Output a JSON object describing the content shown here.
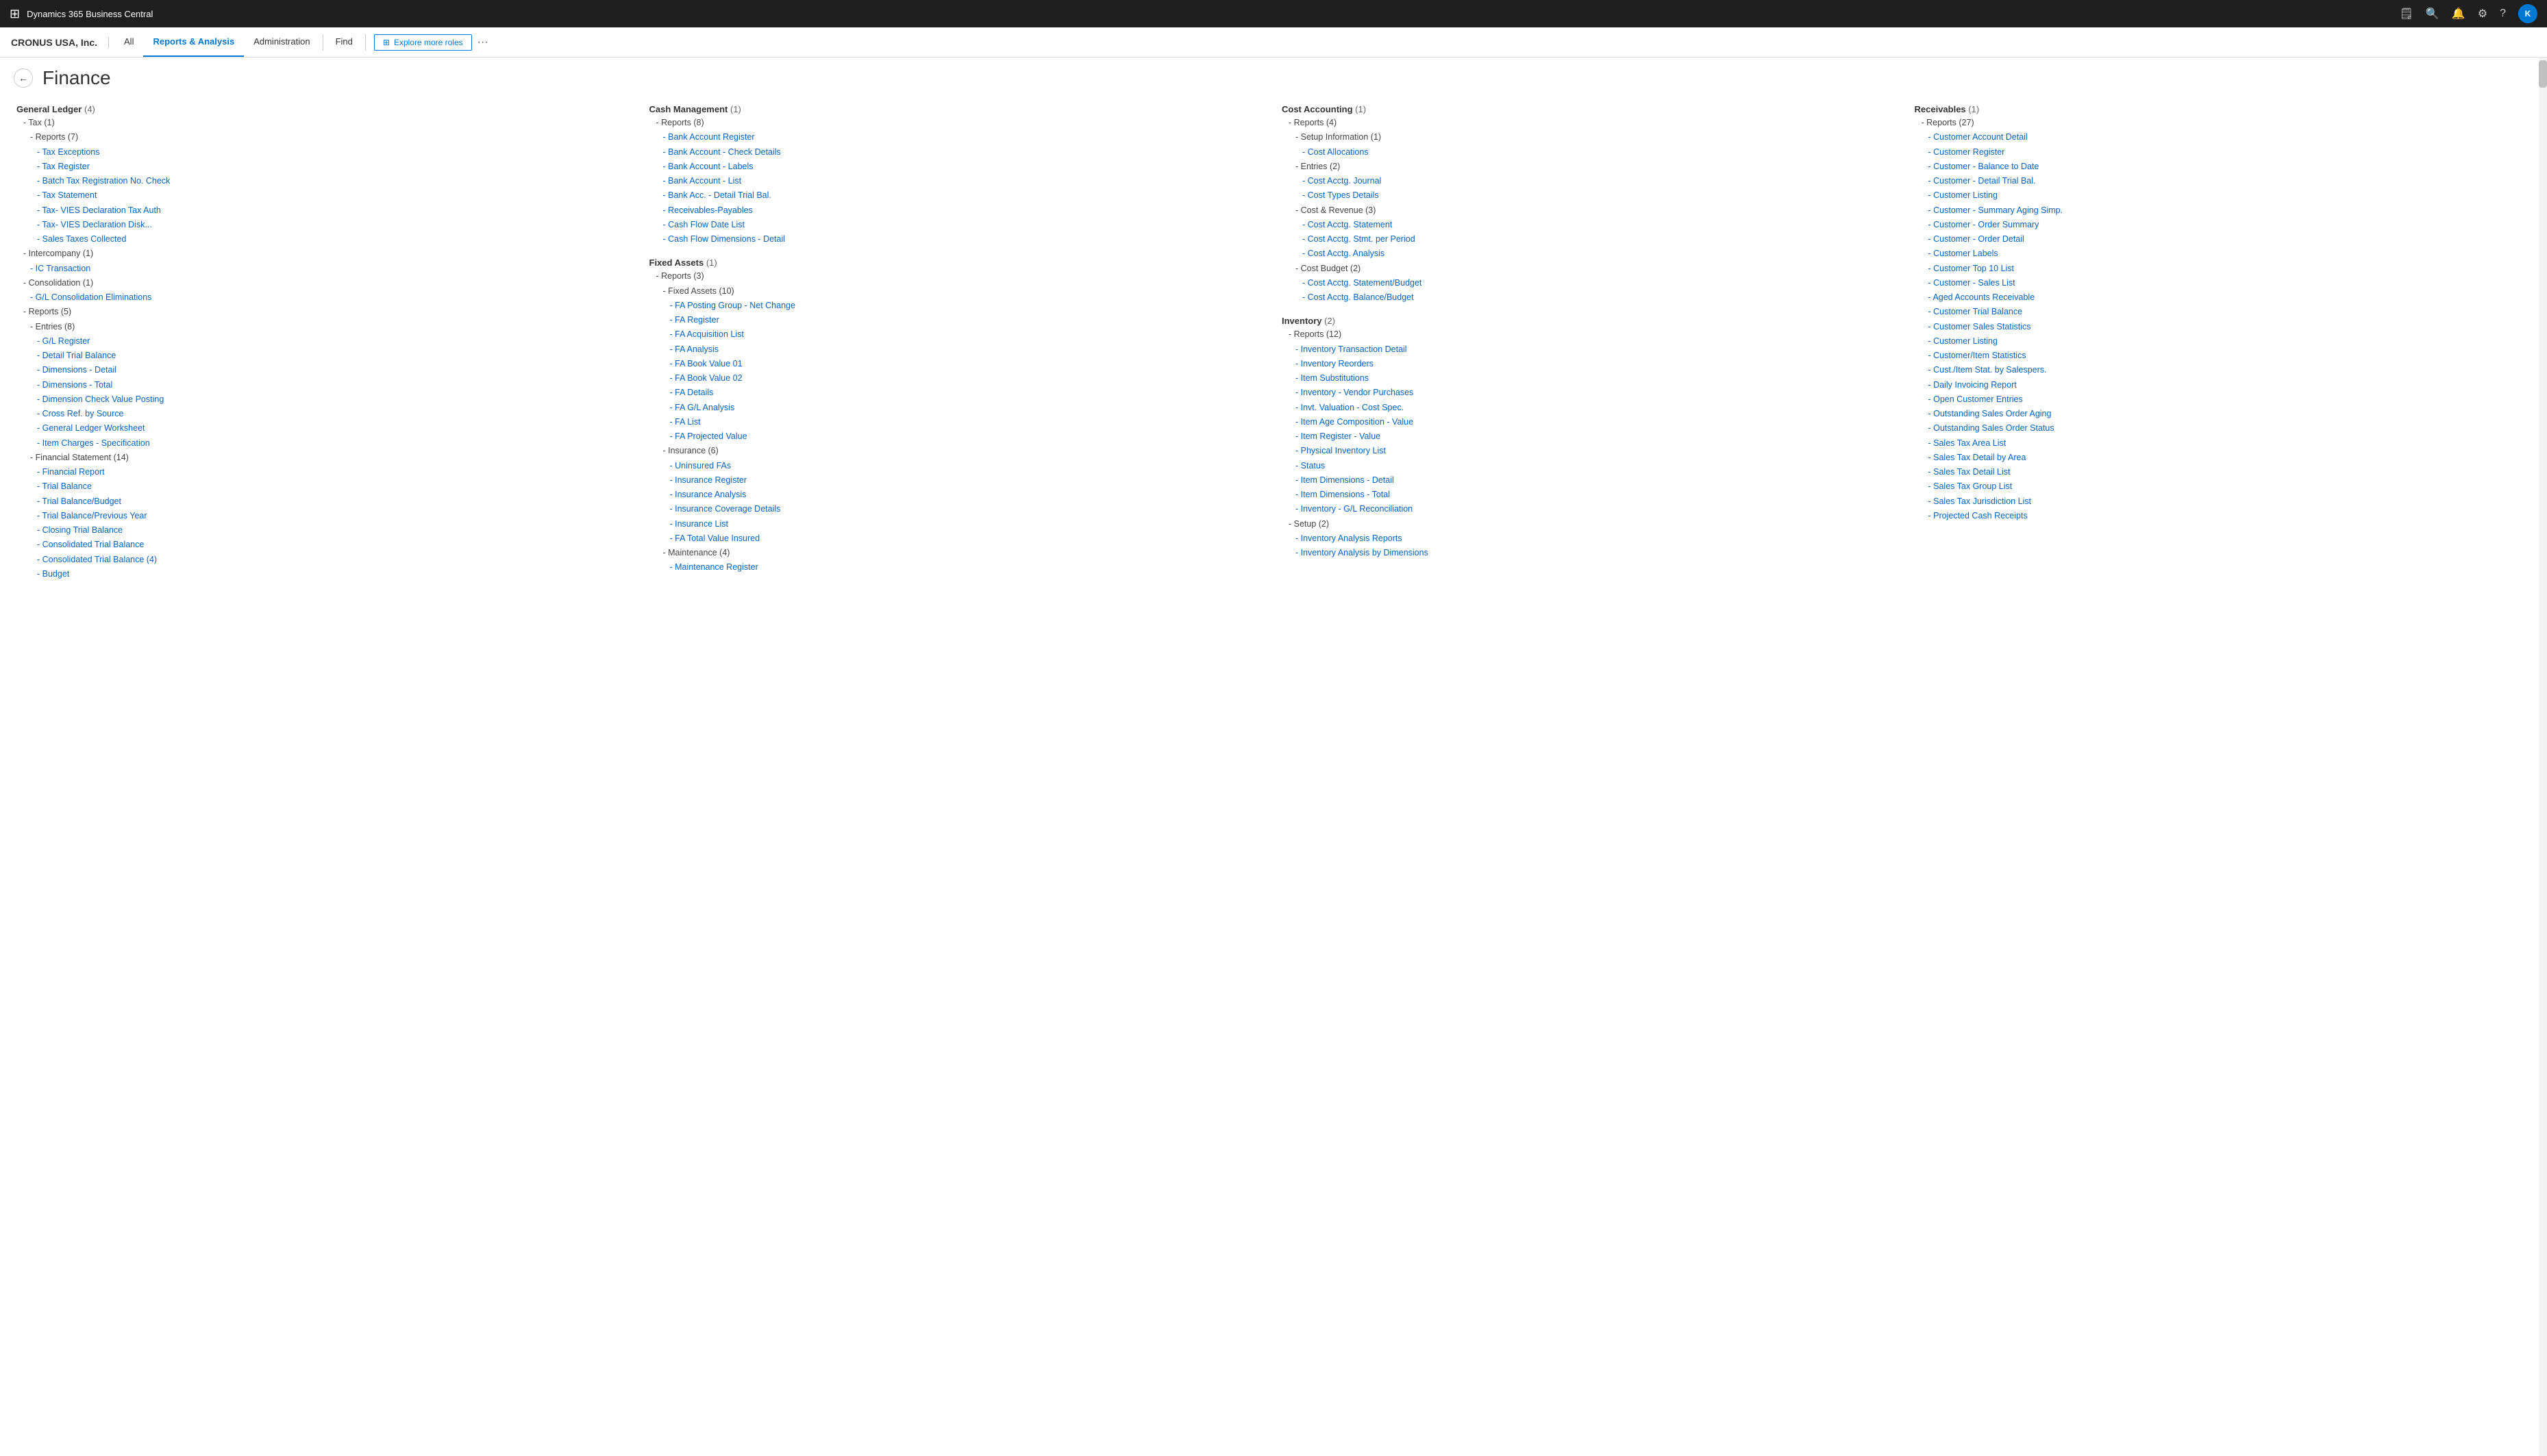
{
  "topbar": {
    "title": "Dynamics 365 Business Central",
    "avatar": "K"
  },
  "companybar": {
    "company": "CRONUS USA, Inc.",
    "tabs": [
      "All",
      "Reports & Analysis",
      "Administration",
      "Find"
    ],
    "active_tab": "Reports & Analysis",
    "explore_label": "Explore more roles"
  },
  "page": {
    "title": "Finance",
    "back": "back"
  },
  "columns": {
    "col1": {
      "header": "General Ledger",
      "count": "(4)",
      "sections": [
        {
          "label": "- Tax (1)",
          "indent": 1,
          "link": false
        },
        {
          "label": "- Reports (7)",
          "indent": 2,
          "link": false
        },
        {
          "label": "- Tax Exceptions",
          "indent": 3,
          "link": true
        },
        {
          "label": "- Tax Register",
          "indent": 3,
          "link": true
        },
        {
          "label": "- Batch Tax Registration No. Check",
          "indent": 3,
          "link": true
        },
        {
          "label": "- Tax Statement",
          "indent": 3,
          "link": true
        },
        {
          "label": "- Tax- VIES Declaration Tax Auth",
          "indent": 3,
          "link": true
        },
        {
          "label": "- Tax- VIES Declaration Disk...",
          "indent": 3,
          "link": true
        },
        {
          "label": "- Sales Taxes Collected",
          "indent": 3,
          "link": true
        },
        {
          "label": "- Intercompany (1)",
          "indent": 1,
          "link": false
        },
        {
          "label": "- IC Transaction",
          "indent": 2,
          "link": true
        },
        {
          "label": "- Consolidation (1)",
          "indent": 1,
          "link": false
        },
        {
          "label": "- G/L Consolidation Eliminations",
          "indent": 2,
          "link": true
        },
        {
          "label": "- Reports (5)",
          "indent": 1,
          "link": false
        },
        {
          "label": "- Entries (8)",
          "indent": 2,
          "link": false
        },
        {
          "label": "- G/L Register",
          "indent": 3,
          "link": true
        },
        {
          "label": "- Detail Trial Balance",
          "indent": 3,
          "link": true
        },
        {
          "label": "- Dimensions - Detail",
          "indent": 3,
          "link": true
        },
        {
          "label": "- Dimensions - Total",
          "indent": 3,
          "link": true
        },
        {
          "label": "- Dimension Check Value Posting",
          "indent": 3,
          "link": true
        },
        {
          "label": "- Cross Ref. by Source",
          "indent": 3,
          "link": true
        },
        {
          "label": "- General Ledger Worksheet",
          "indent": 3,
          "link": true
        },
        {
          "label": "- Item Charges - Specification",
          "indent": 3,
          "link": true
        },
        {
          "label": "- Financial Statement (14)",
          "indent": 2,
          "link": false
        },
        {
          "label": "- Financial Report",
          "indent": 3,
          "link": true
        },
        {
          "label": "- Trial Balance",
          "indent": 3,
          "link": true
        },
        {
          "label": "- Trial Balance/Budget",
          "indent": 3,
          "link": true
        },
        {
          "label": "- Trial Balance/Previous Year",
          "indent": 3,
          "link": true
        },
        {
          "label": "- Closing Trial Balance",
          "indent": 3,
          "link": true
        },
        {
          "label": "- Consolidated Trial Balance",
          "indent": 3,
          "link": true
        },
        {
          "label": "- Consolidated Trial Balance (4)",
          "indent": 3,
          "link": true
        },
        {
          "label": "- Budget",
          "indent": 3,
          "link": true
        }
      ]
    },
    "col2": {
      "header": "Cash Management",
      "count": "(1)",
      "sections": [
        {
          "label": "- Reports (8)",
          "indent": 1,
          "link": false
        },
        {
          "label": "- Bank Account Register",
          "indent": 2,
          "link": true
        },
        {
          "label": "- Bank Account - Check Details",
          "indent": 2,
          "link": true
        },
        {
          "label": "- Bank Account - Labels",
          "indent": 2,
          "link": true
        },
        {
          "label": "- Bank Account - List",
          "indent": 2,
          "link": true
        },
        {
          "label": "- Bank Acc. - Detail Trial Bal.",
          "indent": 2,
          "link": true
        },
        {
          "label": "- Receivables-Payables",
          "indent": 2,
          "link": true
        },
        {
          "label": "- Cash Flow Date List",
          "indent": 2,
          "link": true
        },
        {
          "label": "- Cash Flow Dimensions - Detail",
          "indent": 2,
          "link": true
        },
        {
          "label": "Fixed Assets",
          "indent": 0,
          "link": false,
          "header": true,
          "count": "(1)"
        },
        {
          "label": "- Reports (3)",
          "indent": 1,
          "link": false
        },
        {
          "label": "- Fixed Assets (10)",
          "indent": 2,
          "link": false
        },
        {
          "label": "- FA Posting Group - Net Change",
          "indent": 3,
          "link": true
        },
        {
          "label": "- FA Register",
          "indent": 3,
          "link": true
        },
        {
          "label": "- FA Acquisition List",
          "indent": 3,
          "link": true
        },
        {
          "label": "- FA Analysis",
          "indent": 3,
          "link": true
        },
        {
          "label": "- FA Book Value 01",
          "indent": 3,
          "link": true
        },
        {
          "label": "- FA Book Value 02",
          "indent": 3,
          "link": true
        },
        {
          "label": "- FA Details",
          "indent": 3,
          "link": true
        },
        {
          "label": "- FA G/L Analysis",
          "indent": 3,
          "link": true
        },
        {
          "label": "- FA List",
          "indent": 3,
          "link": true
        },
        {
          "label": "- FA Projected Value",
          "indent": 3,
          "link": true
        },
        {
          "label": "- Insurance (6)",
          "indent": 2,
          "link": false
        },
        {
          "label": "- Uninsured FAs",
          "indent": 3,
          "link": true
        },
        {
          "label": "- Insurance Register",
          "indent": 3,
          "link": true
        },
        {
          "label": "- Insurance Analysis",
          "indent": 3,
          "link": true
        },
        {
          "label": "- Insurance Coverage Details",
          "indent": 3,
          "link": true
        },
        {
          "label": "- Insurance List",
          "indent": 3,
          "link": true
        },
        {
          "label": "- FA Total Value Insured",
          "indent": 3,
          "link": true
        },
        {
          "label": "- Maintenance (4)",
          "indent": 2,
          "link": false
        },
        {
          "label": "- Maintenance Register",
          "indent": 3,
          "link": true
        }
      ]
    },
    "col3": {
      "header": "Cost Accounting",
      "count": "(1)",
      "sections": [
        {
          "label": "- Reports (4)",
          "indent": 1,
          "link": false
        },
        {
          "label": "- Setup Information (1)",
          "indent": 2,
          "link": false
        },
        {
          "label": "- Cost Allocations",
          "indent": 3,
          "link": true
        },
        {
          "label": "- Entries (2)",
          "indent": 2,
          "link": false
        },
        {
          "label": "- Cost Acctg. Journal",
          "indent": 3,
          "link": true
        },
        {
          "label": "- Cost Types Details",
          "indent": 3,
          "link": true
        },
        {
          "label": "- Cost & Revenue (3)",
          "indent": 2,
          "link": false
        },
        {
          "label": "- Cost Acctg. Statement",
          "indent": 3,
          "link": true
        },
        {
          "label": "- Cost Acctg. Stmt. per Period",
          "indent": 3,
          "link": true
        },
        {
          "label": "- Cost Acctg. Analysis",
          "indent": 3,
          "link": true
        },
        {
          "label": "- Cost Budget (2)",
          "indent": 2,
          "link": false
        },
        {
          "label": "- Cost Acctg. Statement/Budget",
          "indent": 3,
          "link": true
        },
        {
          "label": "- Cost Acctg. Balance/Budget",
          "indent": 3,
          "link": true
        },
        {
          "label": "Inventory",
          "indent": 0,
          "link": false,
          "header": true,
          "count": "(2)"
        },
        {
          "label": "- Reports (12)",
          "indent": 1,
          "link": false
        },
        {
          "label": "- Inventory Transaction Detail",
          "indent": 2,
          "link": true
        },
        {
          "label": "- Inventory Reorders",
          "indent": 2,
          "link": true
        },
        {
          "label": "- Item Substitutions",
          "indent": 2,
          "link": true
        },
        {
          "label": "- Inventory - Vendor Purchases",
          "indent": 2,
          "link": true
        },
        {
          "label": "- Invt. Valuation - Cost Spec.",
          "indent": 2,
          "link": true
        },
        {
          "label": "- Item Age Composition - Value",
          "indent": 2,
          "link": true
        },
        {
          "label": "- Item Register - Value",
          "indent": 2,
          "link": true
        },
        {
          "label": "- Physical Inventory List",
          "indent": 2,
          "link": true
        },
        {
          "label": "- Status",
          "indent": 2,
          "link": true
        },
        {
          "label": "- Item Dimensions - Detail",
          "indent": 2,
          "link": true
        },
        {
          "label": "- Item Dimensions - Total",
          "indent": 2,
          "link": true
        },
        {
          "label": "- Inventory - G/L Reconciliation",
          "indent": 2,
          "link": true
        },
        {
          "label": "- Setup (2)",
          "indent": 1,
          "link": false
        },
        {
          "label": "- Inventory Analysis Reports",
          "indent": 2,
          "link": true
        },
        {
          "label": "- Inventory Analysis by Dimensions",
          "indent": 2,
          "link": true
        }
      ]
    },
    "col4": {
      "header": "Receivables",
      "count": "(1)",
      "sections": [
        {
          "label": "- Reports (27)",
          "indent": 1,
          "link": false
        },
        {
          "label": "- Customer Account Detail",
          "indent": 2,
          "link": true
        },
        {
          "label": "- Customer Register",
          "indent": 2,
          "link": true
        },
        {
          "label": "- Customer - Balance to Date",
          "indent": 2,
          "link": true
        },
        {
          "label": "- Customer - Detail Trial Bal.",
          "indent": 2,
          "link": true
        },
        {
          "label": "- Customer Listing",
          "indent": 2,
          "link": true
        },
        {
          "label": "- Customer - Summary Aging Simp.",
          "indent": 2,
          "link": true
        },
        {
          "label": "- Customer - Order Summary",
          "indent": 2,
          "link": true
        },
        {
          "label": "- Customer - Order Detail",
          "indent": 2,
          "link": true
        },
        {
          "label": "- Customer Labels",
          "indent": 2,
          "link": true
        },
        {
          "label": "- Customer Top 10 List",
          "indent": 2,
          "link": true
        },
        {
          "label": "- Customer - Sales List",
          "indent": 2,
          "link": true
        },
        {
          "label": "- Aged Accounts Receivable",
          "indent": 2,
          "link": true
        },
        {
          "label": "- Customer Trial Balance",
          "indent": 2,
          "link": true
        },
        {
          "label": "- Customer Sales Statistics",
          "indent": 2,
          "link": true
        },
        {
          "label": "- Customer Listing",
          "indent": 2,
          "link": true
        },
        {
          "label": "- Customer/Item Statistics",
          "indent": 2,
          "link": true
        },
        {
          "label": "- Cust./Item Stat. by Salespers.",
          "indent": 2,
          "link": true
        },
        {
          "label": "- Daily Invoicing Report",
          "indent": 2,
          "link": true
        },
        {
          "label": "- Open Customer Entries",
          "indent": 2,
          "link": true
        },
        {
          "label": "- Outstanding Sales Order Aging",
          "indent": 2,
          "link": true
        },
        {
          "label": "- Outstanding Sales Order Status",
          "indent": 2,
          "link": true
        },
        {
          "label": "- Sales Tax Area List",
          "indent": 2,
          "link": true
        },
        {
          "label": "- Sales Tax Detail by Area",
          "indent": 2,
          "link": true
        },
        {
          "label": "- Sales Tax Detail List",
          "indent": 2,
          "link": true
        },
        {
          "label": "- Sales Tax Group List",
          "indent": 2,
          "link": true
        },
        {
          "label": "- Sales Tax Jurisdiction List",
          "indent": 2,
          "link": true
        },
        {
          "label": "- Projected Cash Receipts",
          "indent": 2,
          "link": true
        }
      ]
    }
  }
}
